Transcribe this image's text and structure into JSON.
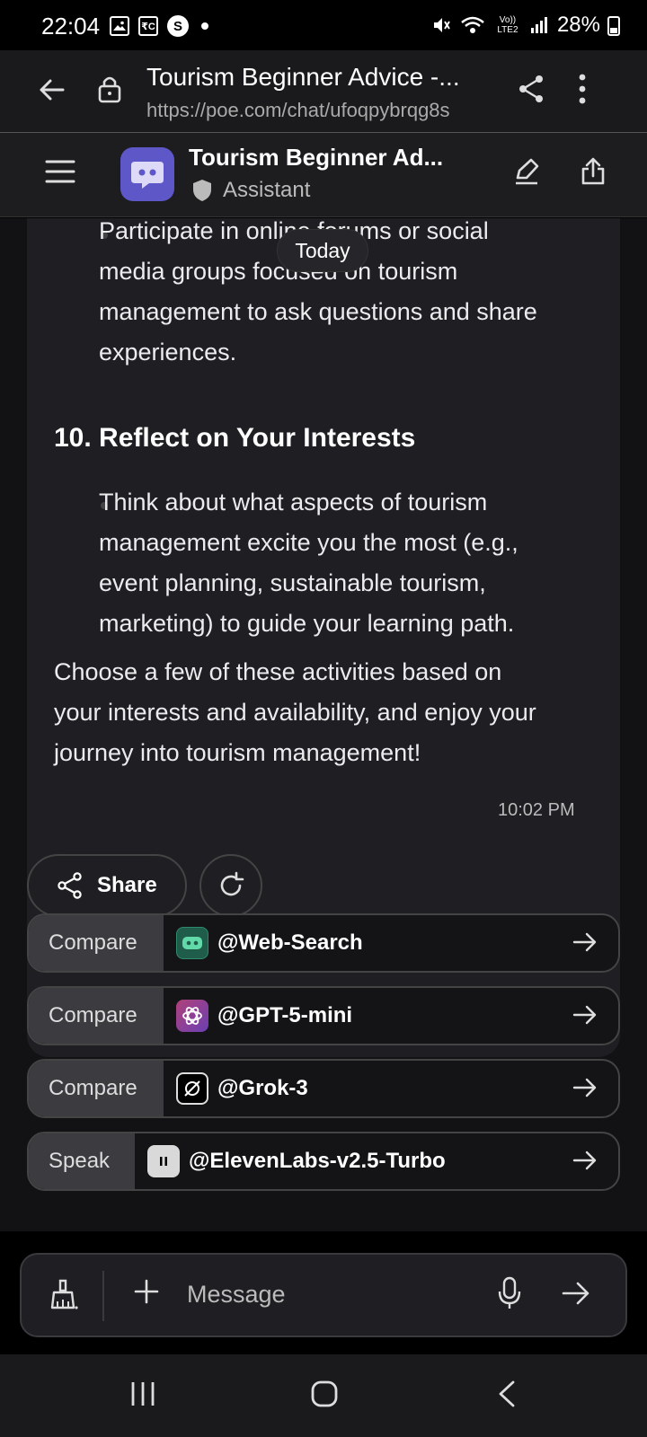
{
  "status_bar": {
    "time": "22:04",
    "icons_left": [
      "gallery-icon",
      "rc-icon",
      "s-icon",
      "dot-icon"
    ],
    "icons_right": [
      "mute-icon",
      "wifi-icon",
      "volte-icon",
      "signal-icon"
    ],
    "network": "Vo)) LTE2",
    "battery": "28%"
  },
  "browser": {
    "title": "Tourism Beginner Advice -...",
    "url": "https://poe.com/chat/ufoqpybrqg8s"
  },
  "app_header": {
    "title": "Tourism Beginner Ad...",
    "subtitle": "Assistant"
  },
  "chat": {
    "today_label": "Today",
    "bullet1_lines": [
      "Participate in online forums or social",
      "media groups focused on tourism",
      "management to ask questions and share",
      "experiences."
    ],
    "heading": "10. Reflect on Your Interests",
    "bullet2_lines": [
      "Think about what aspects of tourism",
      "management excite you the most (e.g.,",
      "event planning, sustainable tourism,",
      "marketing) to guide your learning path."
    ],
    "closing_lines": [
      "Choose a few of these activities based on",
      "your interests and availability, and enjoy your",
      "journey into tourism management!"
    ],
    "timestamp": "10:02 PM"
  },
  "actions": {
    "share_label": "Share"
  },
  "suggestions": [
    {
      "action": "Compare",
      "bot": "@Web-Search",
      "icon": "robot-icon",
      "icon_color": "#1f5c4a"
    },
    {
      "action": "Compare",
      "bot": "@GPT-5-mini",
      "icon": "openai-icon",
      "icon_color": "#b0417a"
    },
    {
      "action": "Compare",
      "bot": "@Grok-3",
      "icon": "grok-icon",
      "icon_color": "#000000"
    },
    {
      "action": "Speak",
      "bot": "@ElevenLabs-v2.5-Turbo",
      "icon": "elevenlabs-icon",
      "icon_color": "#d9d9d9"
    }
  ],
  "composer": {
    "placeholder": "Message"
  },
  "colors": {
    "accent": "#5d57c7",
    "background": "#121214",
    "bubble": "#1f1f23"
  }
}
